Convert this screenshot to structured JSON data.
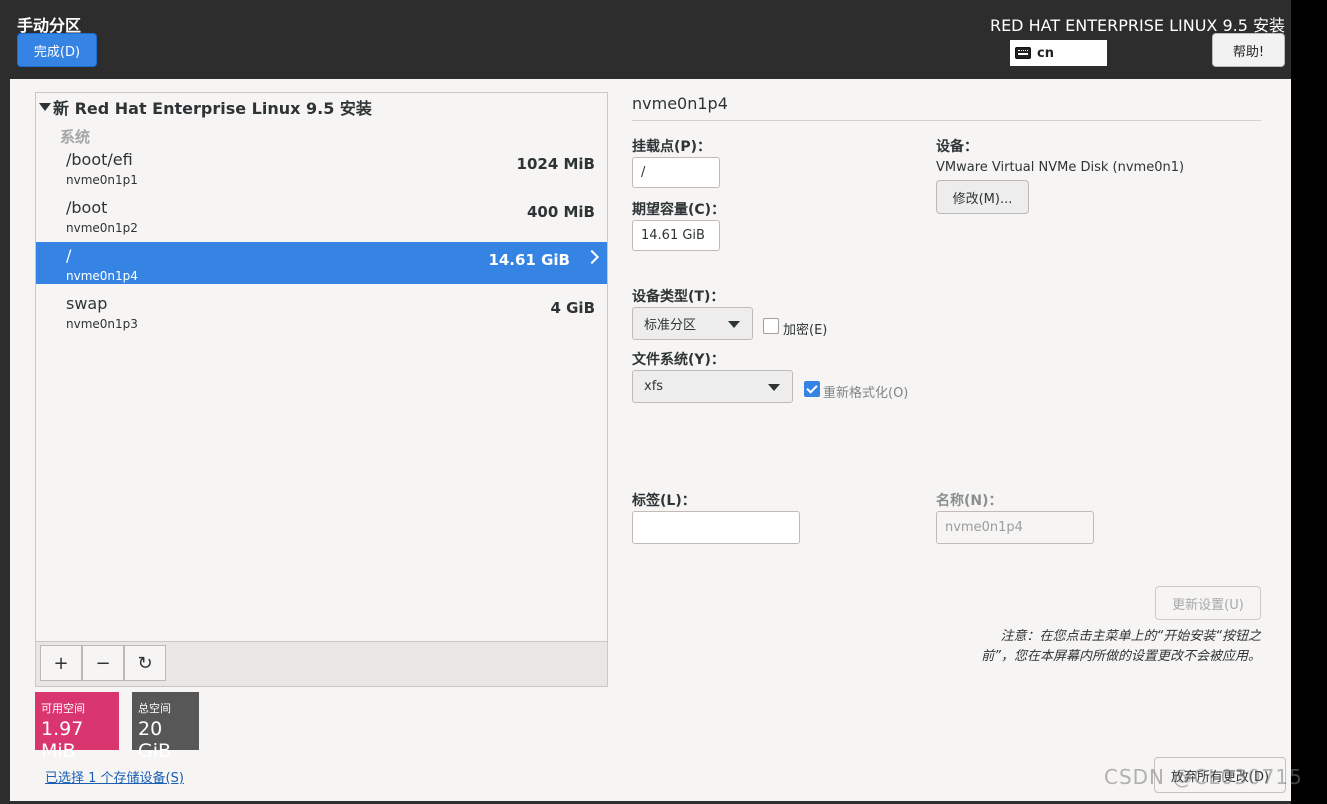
{
  "header": {
    "title": "手动分区",
    "done_label": "完成(D)",
    "product": "RED HAT ENTERPRISE LINUX 9.5 安装",
    "keyboard_layout": "cn",
    "help_label": "帮助!"
  },
  "tree": {
    "root_label": "新 Red Hat Enterprise Linux 9.5 安装",
    "group_label": "系统",
    "partitions": [
      {
        "mount": "/boot/efi",
        "device": "nvme0n1p1",
        "size": "1024 MiB",
        "selected": false
      },
      {
        "mount": "/boot",
        "device": "nvme0n1p2",
        "size": "400 MiB",
        "selected": false
      },
      {
        "mount": "/",
        "device": "nvme0n1p4",
        "size": "14.61 GiB",
        "selected": true
      },
      {
        "mount": "swap",
        "device": "nvme0n1p3",
        "size": "4 GiB",
        "selected": false
      }
    ],
    "toolbar": {
      "add": "+",
      "remove": "−",
      "refresh": "↻"
    }
  },
  "space": {
    "available_label": "可用空间",
    "available_value": "1.97 MiB",
    "total_label": "总空间",
    "total_value": "20 GiB",
    "available_color": "#d9366f",
    "total_color": "#575757"
  },
  "storage_link": "已选择 1 个存储设备(S)",
  "detail": {
    "title": "nvme0n1p4",
    "mount_label": "挂载点(P)：",
    "mount_value": "/",
    "capacity_label": "期望容量(C)：",
    "capacity_value": "14.61 GiB",
    "device_label": "设备：",
    "device_value": "VMware Virtual NVMe Disk (nvme0n1)",
    "modify_label": "修改(M)...",
    "device_type_label": "设备类型(T)：",
    "device_type_value": "标准分区",
    "encrypt_label": "加密(E)",
    "encrypt_checked": false,
    "fs_label": "文件系统(Y)：",
    "fs_value": "xfs",
    "reformat_label": "重新格式化(O)",
    "reformat_checked": true,
    "tag_label": "标签(L)：",
    "tag_value": "",
    "name_label": "名称(N)：",
    "name_value": "nvme0n1p4",
    "update_label": "更新设置(U)",
    "note": "注意：在您点击主菜单上的“开始安装“按钮之前”，您在本屏幕内所做的设置更改不会被应用。",
    "discard_label": "放弃所有更改(D)"
  },
  "watermark": "CSDN @CL030715"
}
